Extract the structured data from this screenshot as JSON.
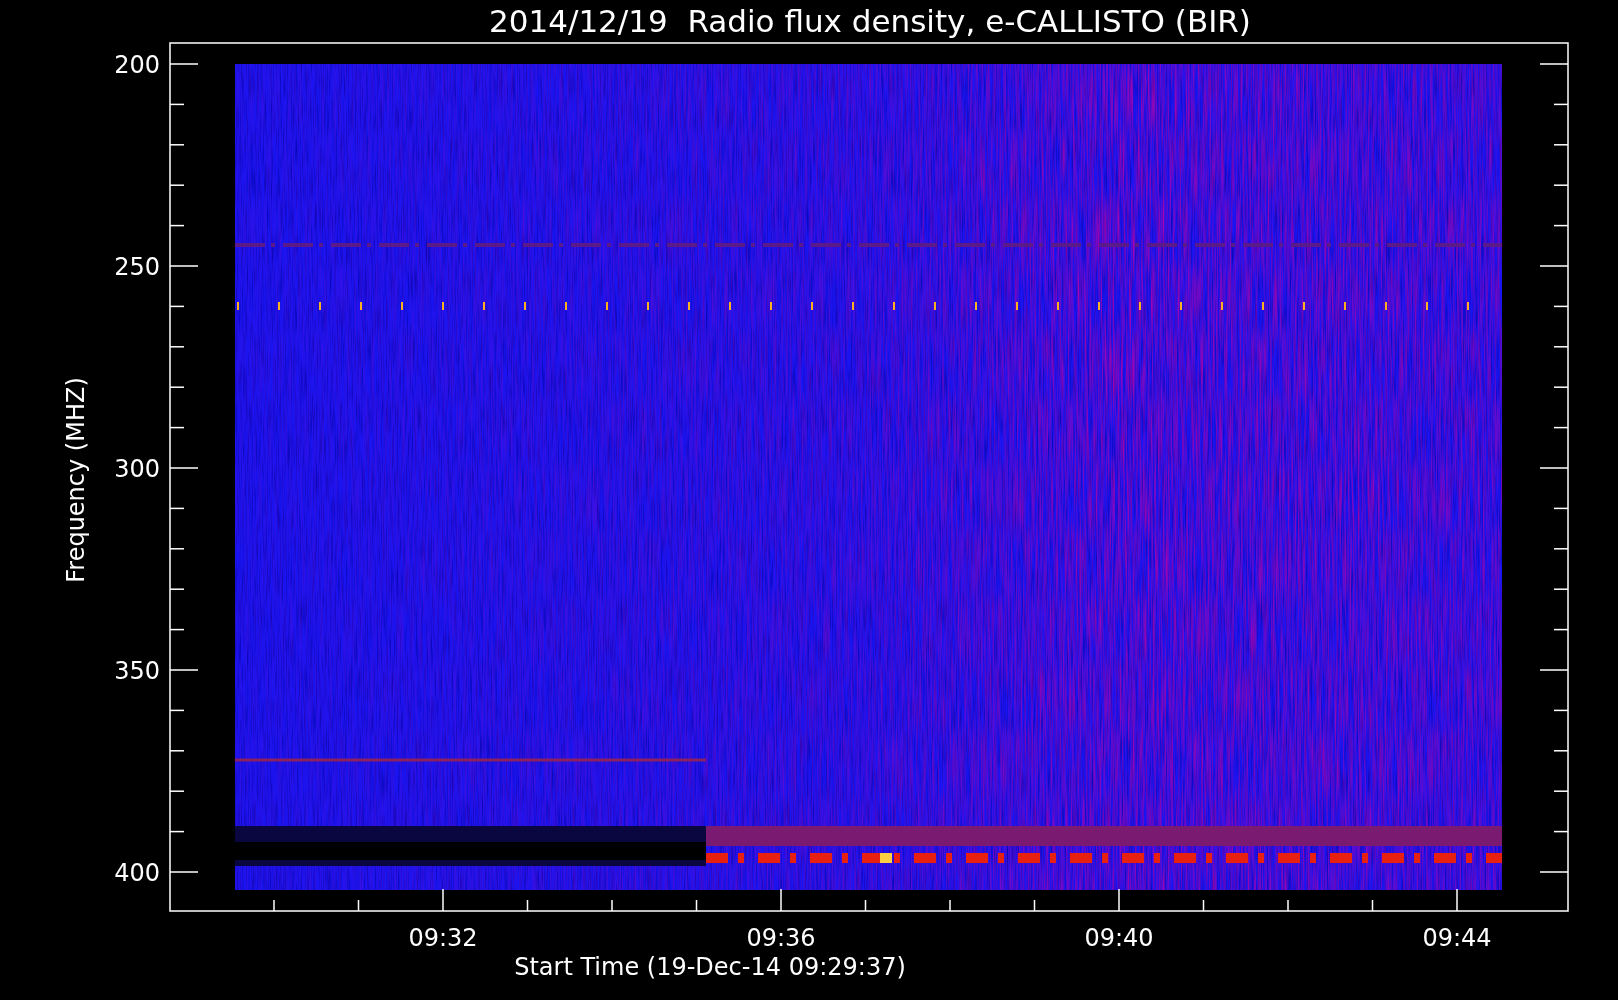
{
  "title": "2014/12/19  Radio flux density, e-CALLISTO (BIR)",
  "y_axis": {
    "label": "Frequency (MHZ)",
    "ticks": [
      "200",
      "250",
      "300",
      "350",
      "400"
    ]
  },
  "x_axis": {
    "label": "Start Time (19-Dec-14 09:29:37)",
    "ticks": [
      "09:32",
      "09:36",
      "09:40",
      "09:44"
    ]
  }
}
